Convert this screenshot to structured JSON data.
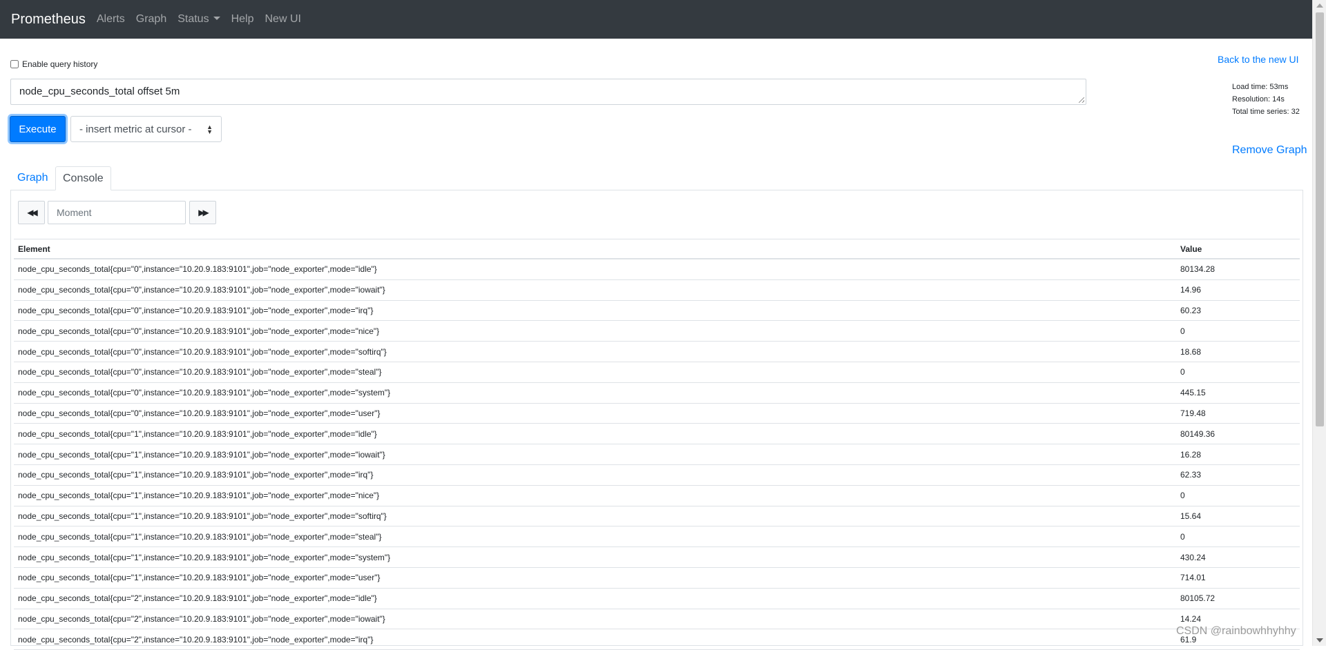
{
  "navbar": {
    "brand": "Prometheus",
    "links": [
      "Alerts",
      "Graph",
      "Status",
      "Help",
      "New UI"
    ]
  },
  "query": {
    "history_label": "Enable query history",
    "expression": "node_cpu_seconds_total offset 5m",
    "execute_label": "Execute",
    "metric_select": "- insert metric at cursor -"
  },
  "side": {
    "back_link": "Back to the new UI",
    "load_time": "Load time: 53ms",
    "resolution": "Resolution: 14s",
    "total_series": "Total time series: 32",
    "remove_graph": "Remove Graph"
  },
  "tabs": {
    "graph": "Graph",
    "console": "Console"
  },
  "console": {
    "moment_placeholder": "Moment",
    "columns": {
      "element": "Element",
      "value": "Value"
    },
    "rows": [
      {
        "element": "node_cpu_seconds_total{cpu=\"0\",instance=\"10.20.9.183:9101\",job=\"node_exporter\",mode=\"idle\"}",
        "value": "80134.28"
      },
      {
        "element": "node_cpu_seconds_total{cpu=\"0\",instance=\"10.20.9.183:9101\",job=\"node_exporter\",mode=\"iowait\"}",
        "value": "14.96"
      },
      {
        "element": "node_cpu_seconds_total{cpu=\"0\",instance=\"10.20.9.183:9101\",job=\"node_exporter\",mode=\"irq\"}",
        "value": "60.23"
      },
      {
        "element": "node_cpu_seconds_total{cpu=\"0\",instance=\"10.20.9.183:9101\",job=\"node_exporter\",mode=\"nice\"}",
        "value": "0"
      },
      {
        "element": "node_cpu_seconds_total{cpu=\"0\",instance=\"10.20.9.183:9101\",job=\"node_exporter\",mode=\"softirq\"}",
        "value": "18.68"
      },
      {
        "element": "node_cpu_seconds_total{cpu=\"0\",instance=\"10.20.9.183:9101\",job=\"node_exporter\",mode=\"steal\"}",
        "value": "0"
      },
      {
        "element": "node_cpu_seconds_total{cpu=\"0\",instance=\"10.20.9.183:9101\",job=\"node_exporter\",mode=\"system\"}",
        "value": "445.15"
      },
      {
        "element": "node_cpu_seconds_total{cpu=\"0\",instance=\"10.20.9.183:9101\",job=\"node_exporter\",mode=\"user\"}",
        "value": "719.48"
      },
      {
        "element": "node_cpu_seconds_total{cpu=\"1\",instance=\"10.20.9.183:9101\",job=\"node_exporter\",mode=\"idle\"}",
        "value": "80149.36"
      },
      {
        "element": "node_cpu_seconds_total{cpu=\"1\",instance=\"10.20.9.183:9101\",job=\"node_exporter\",mode=\"iowait\"}",
        "value": "16.28"
      },
      {
        "element": "node_cpu_seconds_total{cpu=\"1\",instance=\"10.20.9.183:9101\",job=\"node_exporter\",mode=\"irq\"}",
        "value": "62.33"
      },
      {
        "element": "node_cpu_seconds_total{cpu=\"1\",instance=\"10.20.9.183:9101\",job=\"node_exporter\",mode=\"nice\"}",
        "value": "0"
      },
      {
        "element": "node_cpu_seconds_total{cpu=\"1\",instance=\"10.20.9.183:9101\",job=\"node_exporter\",mode=\"softirq\"}",
        "value": "15.64"
      },
      {
        "element": "node_cpu_seconds_total{cpu=\"1\",instance=\"10.20.9.183:9101\",job=\"node_exporter\",mode=\"steal\"}",
        "value": "0"
      },
      {
        "element": "node_cpu_seconds_total{cpu=\"1\",instance=\"10.20.9.183:9101\",job=\"node_exporter\",mode=\"system\"}",
        "value": "430.24"
      },
      {
        "element": "node_cpu_seconds_total{cpu=\"1\",instance=\"10.20.9.183:9101\",job=\"node_exporter\",mode=\"user\"}",
        "value": "714.01"
      },
      {
        "element": "node_cpu_seconds_total{cpu=\"2\",instance=\"10.20.9.183:9101\",job=\"node_exporter\",mode=\"idle\"}",
        "value": "80105.72"
      },
      {
        "element": "node_cpu_seconds_total{cpu=\"2\",instance=\"10.20.9.183:9101\",job=\"node_exporter\",mode=\"iowait\"}",
        "value": "14.24"
      },
      {
        "element": "node_cpu_seconds_total{cpu=\"2\",instance=\"10.20.9.183:9101\",job=\"node_exporter\",mode=\"irq\"}",
        "value": "61.9"
      }
    ]
  },
  "watermark": "CSDN @rainbowhhyhhy"
}
